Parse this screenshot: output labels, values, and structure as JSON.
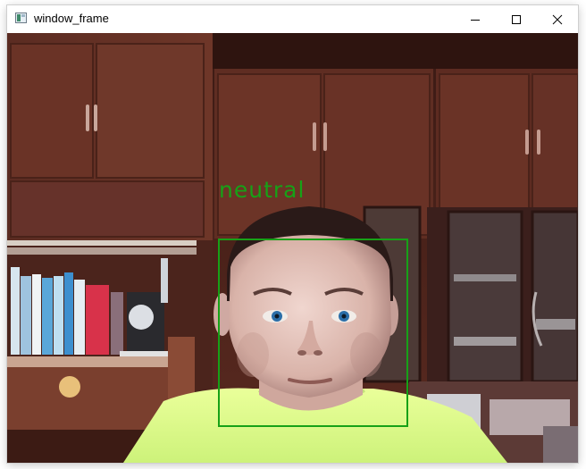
{
  "window": {
    "title": "window_frame",
    "controls": {
      "minimize_icon": "minimize-icon",
      "maximize_icon": "maximize-icon",
      "close_icon": "close-icon"
    }
  },
  "detection": {
    "label": "neutral"
  },
  "colors": {
    "detection": "#17a117",
    "titlebar": "#ffffff",
    "title_text": "#000000"
  }
}
